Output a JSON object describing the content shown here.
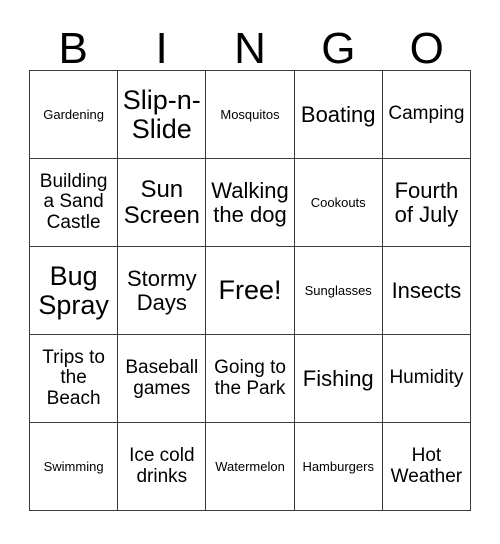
{
  "card": {
    "title": "BINGO",
    "headers": [
      "B",
      "I",
      "N",
      "G",
      "O"
    ],
    "rows": [
      [
        {
          "label": "Gardening",
          "size": "xs"
        },
        {
          "label": "Slip-n-Slide",
          "size": "xl"
        },
        {
          "label": "Mosquitos",
          "size": "xs"
        },
        {
          "label": "Boating",
          "size": "md"
        },
        {
          "label": "Camping",
          "size": "sm"
        }
      ],
      [
        {
          "label": "Building a Sand Castle",
          "size": "sm"
        },
        {
          "label": "Sun Screen",
          "size": "lg"
        },
        {
          "label": "Walking the dog",
          "size": "md"
        },
        {
          "label": "Cookouts",
          "size": "xs"
        },
        {
          "label": "Fourth of July",
          "size": "md"
        }
      ],
      [
        {
          "label": "Bug Spray",
          "size": "xl"
        },
        {
          "label": "Stormy Days",
          "size": "md"
        },
        {
          "label": "Free!",
          "size": "xl"
        },
        {
          "label": "Sunglasses",
          "size": "xs"
        },
        {
          "label": "Insects",
          "size": "md"
        }
      ],
      [
        {
          "label": "Trips to the Beach",
          "size": "sm"
        },
        {
          "label": "Baseball games",
          "size": "sm"
        },
        {
          "label": "Going to the Park",
          "size": "sm"
        },
        {
          "label": "Fishing",
          "size": "md"
        },
        {
          "label": "Humidity",
          "size": "sm"
        }
      ],
      [
        {
          "label": "Swimming",
          "size": "xs"
        },
        {
          "label": "Ice cold drinks",
          "size": "sm"
        },
        {
          "label": "Watermelon",
          "size": "xs"
        },
        {
          "label": "Hamburgers",
          "size": "xs"
        },
        {
          "label": "Hot Weather",
          "size": "sm"
        }
      ]
    ]
  },
  "colors": {
    "grid_line": "#3a3a3a",
    "text": "#000000",
    "background": "#ffffff"
  }
}
